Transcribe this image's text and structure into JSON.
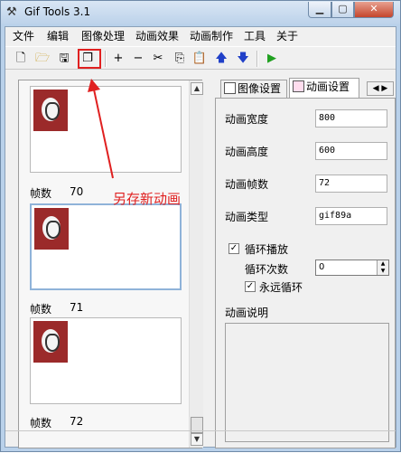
{
  "window": {
    "title": "Gif Tools 3.1"
  },
  "menu": [
    "文件",
    "编辑",
    "图像处理",
    "动画效果",
    "动画制作",
    "工具",
    "关于"
  ],
  "toolbar": {
    "icons": [
      "new-icon",
      "open-folder-icon",
      "save-icon",
      "save-as-new-animation-icon",
      "add-frame-icon",
      "remove-frame-icon",
      "cut-icon",
      "copy-icon",
      "paste-icon",
      "move-up-icon",
      "move-down-icon",
      "play-icon"
    ]
  },
  "annotation": {
    "text": "另存新动画",
    "color": "#e02020"
  },
  "frames": {
    "label": "帧数",
    "items": [
      {
        "number": "70"
      },
      {
        "number": "71"
      },
      {
        "number": "72"
      }
    ]
  },
  "tabs": {
    "image_settings": "图像设置",
    "animation_settings": "动画设置"
  },
  "animation": {
    "width_label": "动画宽度",
    "width": "800",
    "height_label": "动画高度",
    "height": "600",
    "frames_label": "动画帧数",
    "frames": "72",
    "type_label": "动画类型",
    "type": "gif89a",
    "loop_label": "循环播放",
    "loop_checked": true,
    "loop_count_label": "循环次数",
    "loop_count": "0",
    "forever_label": "永远循环",
    "forever_checked": true,
    "desc_label": "动画说明"
  }
}
